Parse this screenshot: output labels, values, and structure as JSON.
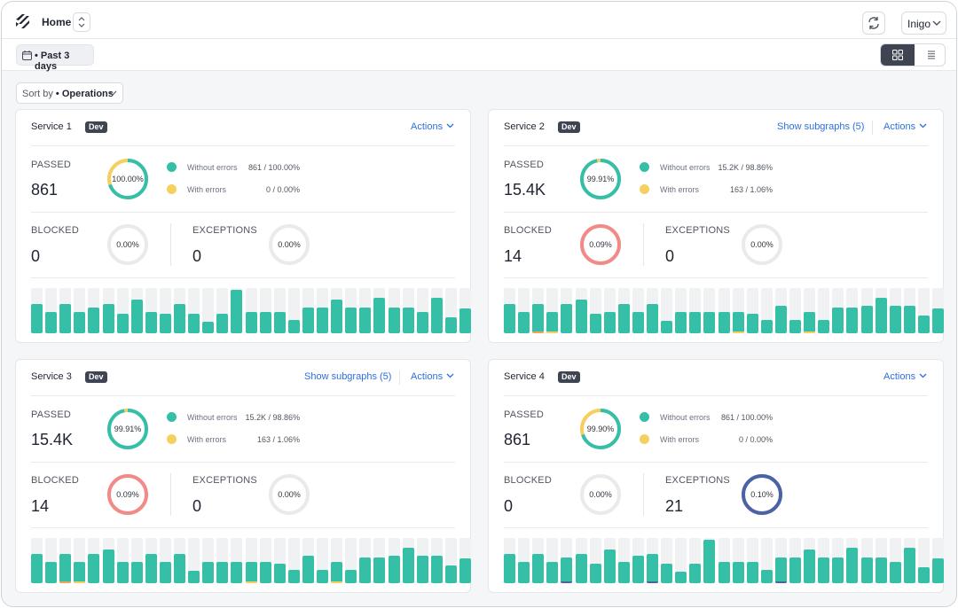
{
  "header": {
    "home_label": "Home",
    "user_label": "Inigo"
  },
  "toolbar": {
    "date_range_label": "• Past 3 days",
    "sort_label": "Sort by",
    "sort_value": "• Operations"
  },
  "colors": {
    "passed": "#36bfa7",
    "with_errors": "#f5d061",
    "blocked": "#f28b88",
    "exceptions": "#4b63a5",
    "empty": "#e9eaec",
    "accent_link": "#2f6fde",
    "badge": "#3f4452"
  },
  "cards": [
    {
      "title": "Service 1",
      "env": "Dev",
      "show_subgraphs": "",
      "actions": "Actions",
      "passed_label": "PASSED",
      "passed_value": "861",
      "passed_pct": "100.00%",
      "passed_fraction": 0.7,
      "passed_error_fraction": 0.3,
      "without_errors_label": "Without errors",
      "without_errors_value": "861 / 100.00%",
      "with_errors_label": "With errors",
      "with_errors_value": "0 / 0.00%",
      "blocked_label": "BLOCKED",
      "blocked_value": "0",
      "blocked_pct": "0.00%",
      "blocked_fraction": 0,
      "exceptions_label": "EXCEPTIONS",
      "exceptions_value": "0",
      "exceptions_pct": "0.00%",
      "exceptions_fraction": 0,
      "bars": [
        0.65,
        0.48,
        0.65,
        0.48,
        0.57,
        0.65,
        0.43,
        0.74,
        0.48,
        0.43,
        0.65,
        0.43,
        0.26,
        0.43,
        0.96,
        0.48,
        0.48,
        0.48,
        0.3,
        0.57,
        0.57,
        0.74,
        0.57,
        0.57,
        0.78,
        0.57,
        0.57,
        0.48,
        0.78,
        0.35,
        0.54
      ],
      "bar_errors": []
    },
    {
      "title": "Service 2",
      "env": "Dev",
      "show_subgraphs": "Show subgraphs (5)",
      "actions": "Actions",
      "passed_label": "PASSED",
      "passed_value": "15.4K",
      "passed_pct": "99.91%",
      "passed_fraction": 0.97,
      "passed_error_fraction": 0.03,
      "without_errors_label": "Without errors",
      "without_errors_value": "15.2K / 98.86%",
      "with_errors_label": "With errors",
      "with_errors_value": "163 / 1.06%",
      "blocked_label": "BLOCKED",
      "blocked_value": "14",
      "blocked_pct": "0.09%",
      "blocked_fraction": 1,
      "exceptions_label": "EXCEPTIONS",
      "exceptions_value": "0",
      "exceptions_pct": "0.00%",
      "exceptions_fraction": 0,
      "bars": [
        0.65,
        0.48,
        0.65,
        0.48,
        0.65,
        0.74,
        0.43,
        0.48,
        0.65,
        0.48,
        0.65,
        0.28,
        0.48,
        0.48,
        0.48,
        0.48,
        0.48,
        0.43,
        0.3,
        0.61,
        0.3,
        0.48,
        0.3,
        0.57,
        0.57,
        0.61,
        0.78,
        0.61,
        0.61,
        0.39,
        0.54
      ],
      "bar_errors": [
        {
          "index": 2,
          "color": "#f0a35e"
        },
        {
          "index": 3,
          "color": "#f5d061"
        },
        {
          "index": 16,
          "color": "#f5d061"
        },
        {
          "index": 21,
          "color": "#f5d061"
        }
      ]
    },
    {
      "title": "Service 3",
      "env": "Dev",
      "show_subgraphs": "Show subgraphs (5)",
      "actions": "Actions",
      "passed_label": "PASSED",
      "passed_value": "15.4K",
      "passed_pct": "99.91%",
      "passed_fraction": 0.97,
      "passed_error_fraction": 0.03,
      "without_errors_label": "Without errors",
      "without_errors_value": "15.2K / 98.86%",
      "with_errors_label": "With errors",
      "with_errors_value": "163 / 1.06%",
      "blocked_label": "BLOCKED",
      "blocked_value": "14",
      "blocked_pct": "0.09%",
      "blocked_fraction": 1,
      "exceptions_label": "EXCEPTIONS",
      "exceptions_value": "0",
      "exceptions_pct": "0.00%",
      "exceptions_fraction": 0,
      "bars": [
        0.65,
        0.48,
        0.65,
        0.48,
        0.65,
        0.74,
        0.48,
        0.48,
        0.65,
        0.48,
        0.65,
        0.28,
        0.48,
        0.48,
        0.48,
        0.48,
        0.48,
        0.43,
        0.3,
        0.61,
        0.3,
        0.48,
        0.3,
        0.57,
        0.57,
        0.61,
        0.78,
        0.61,
        0.61,
        0.39,
        0.54
      ],
      "bar_errors": [
        {
          "index": 2,
          "color": "#f0a35e"
        },
        {
          "index": 3,
          "color": "#f5d061"
        },
        {
          "index": 15,
          "color": "#f5d061"
        },
        {
          "index": 21,
          "color": "#f5d061"
        }
      ]
    },
    {
      "title": "Service 4",
      "env": "Dev",
      "show_subgraphs": "",
      "actions": "Actions",
      "passed_label": "PASSED",
      "passed_value": "861",
      "passed_pct": "99.90%",
      "passed_fraction": 0.7,
      "passed_error_fraction": 0.3,
      "without_errors_label": "Without errors",
      "without_errors_value": "861 / 100.00%",
      "with_errors_label": "With errors",
      "with_errors_value": "0 / 0.00%",
      "blocked_label": "BLOCKED",
      "blocked_value": "0",
      "blocked_pct": "0.00%",
      "blocked_fraction": 0,
      "exceptions_label": "EXCEPTIONS",
      "exceptions_value": "21",
      "exceptions_pct": "0.10%",
      "exceptions_fraction": 1,
      "bars": [
        0.65,
        0.48,
        0.65,
        0.48,
        0.57,
        0.65,
        0.43,
        0.74,
        0.48,
        0.61,
        0.65,
        0.43,
        0.26,
        0.43,
        0.96,
        0.48,
        0.48,
        0.48,
        0.3,
        0.57,
        0.57,
        0.74,
        0.57,
        0.57,
        0.78,
        0.57,
        0.57,
        0.48,
        0.78,
        0.35,
        0.54
      ],
      "bar_errors": [
        {
          "index": 4,
          "color": "#4b63a5"
        },
        {
          "index": 10,
          "color": "#4b63a5"
        },
        {
          "index": 19,
          "color": "#4b63a5"
        }
      ]
    }
  ]
}
